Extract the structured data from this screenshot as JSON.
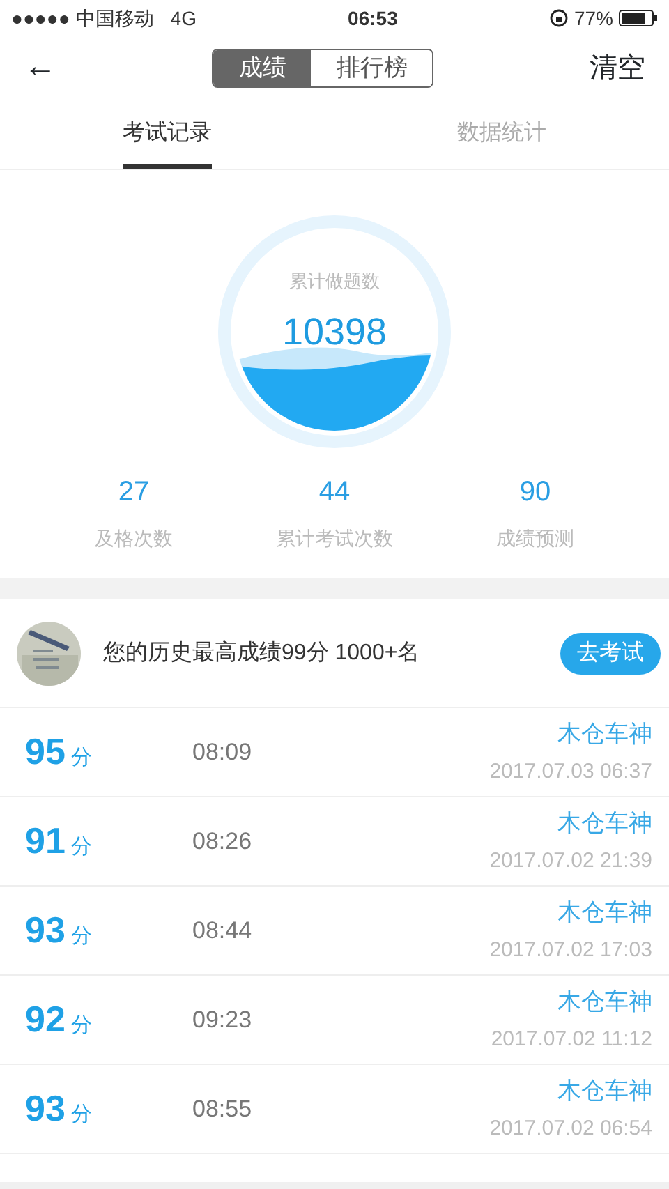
{
  "status_bar": {
    "signal": "●●●●●",
    "carrier": "中国移动",
    "network": "4G",
    "time": "06:53",
    "battery": "77%"
  },
  "nav": {
    "back": "←",
    "segments": [
      {
        "label": "成绩",
        "selected": true
      },
      {
        "label": "排行榜",
        "selected": false
      }
    ],
    "action": "清空"
  },
  "tabs": [
    {
      "label": "考试记录",
      "selected": true
    },
    {
      "label": "数据统计",
      "selected": false
    }
  ],
  "gauge": {
    "label": "累计做题数",
    "value": "10398"
  },
  "stats": [
    {
      "value": "27",
      "label": "及格次数"
    },
    {
      "value": "44",
      "label": "累计考试次数"
    },
    {
      "value": "90",
      "label": "成绩预测"
    }
  ],
  "best": {
    "text": "您的历史最高成绩99分 1000+名",
    "button": "去考试"
  },
  "records": [
    {
      "score": "95",
      "unit": "分",
      "duration": "08:09",
      "name": "木仓车神",
      "date": "2017.07.03 06:37"
    },
    {
      "score": "91",
      "unit": "分",
      "duration": "08:26",
      "name": "木仓车神",
      "date": "2017.07.02 21:39"
    },
    {
      "score": "93",
      "unit": "分",
      "duration": "08:44",
      "name": "木仓车神",
      "date": "2017.07.02 17:03"
    },
    {
      "score": "92",
      "unit": "分",
      "duration": "09:23",
      "name": "木仓车神",
      "date": "2017.07.02 11:12"
    },
    {
      "score": "93",
      "unit": "分",
      "duration": "08:55",
      "name": "木仓车神",
      "date": "2017.07.02 06:54"
    }
  ]
}
